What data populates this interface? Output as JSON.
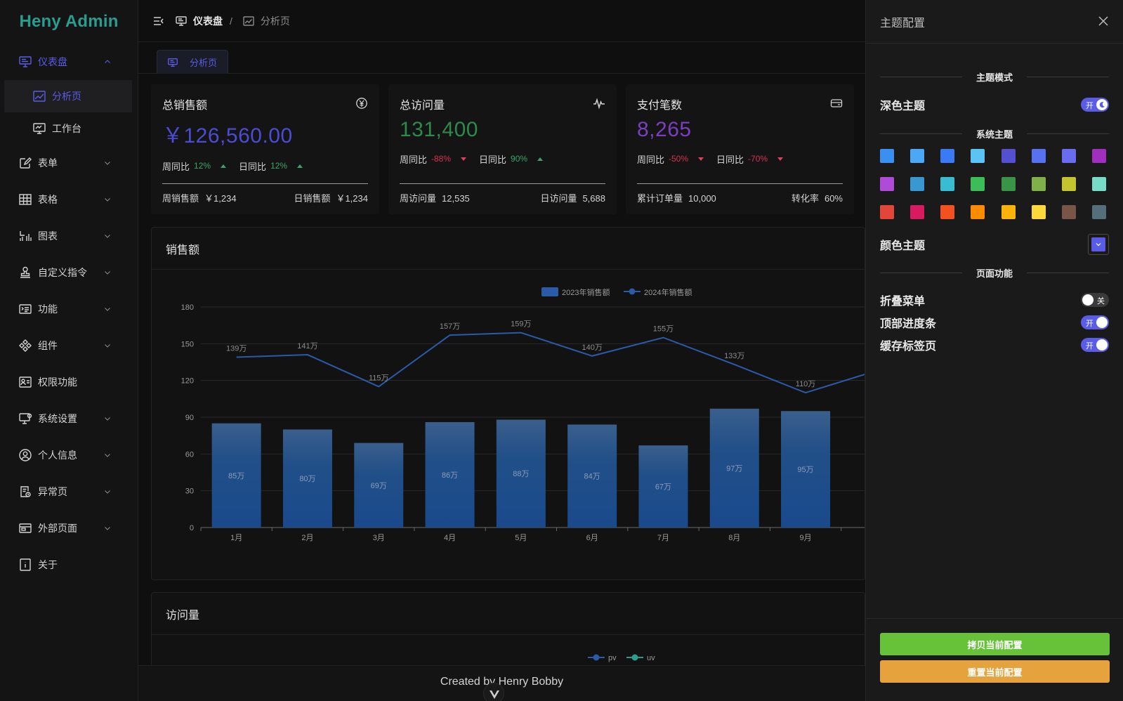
{
  "app": {
    "logo": "Heny Admin"
  },
  "sidebar": {
    "items": [
      {
        "label": "仪表盘",
        "icon": "monitor-icon",
        "expanded": true,
        "active": true,
        "children": [
          {
            "label": "分析页",
            "icon": "chart-image-icon",
            "active": true
          },
          {
            "label": "工作台",
            "icon": "desktop-icon",
            "active": false
          }
        ]
      },
      {
        "label": "表单",
        "icon": "edit-icon"
      },
      {
        "label": "表格",
        "icon": "table-icon"
      },
      {
        "label": "图表",
        "icon": "chart-icon"
      },
      {
        "label": "自定义指令",
        "icon": "stamp-icon"
      },
      {
        "label": "功能",
        "icon": "function-icon"
      },
      {
        "label": "组件",
        "icon": "component-icon"
      },
      {
        "label": "权限功能",
        "icon": "permission-icon"
      },
      {
        "label": "系统设置",
        "icon": "system-settings-icon"
      },
      {
        "label": "个人信息",
        "icon": "user-circle-icon"
      },
      {
        "label": "异常页",
        "icon": "exception-icon"
      },
      {
        "label": "外部页面",
        "icon": "external-page-icon"
      },
      {
        "label": "关于",
        "icon": "info-icon"
      }
    ]
  },
  "header": {
    "breadcrumb": [
      "仪表盘",
      "分析页"
    ],
    "separator": "/"
  },
  "tabs": [
    {
      "label": "分析页",
      "active": true
    }
  ],
  "stats": [
    {
      "title": "总销售额",
      "value": "￥126,560.00",
      "value_color": "#4a4dd4",
      "icon": "yen-icon",
      "week_label": "周同比",
      "week_pct": "12%",
      "week_trend": "up",
      "day_label": "日同比",
      "day_pct": "12%",
      "day_trend": "up",
      "foot_left_label": "周销售额",
      "foot_left_value": "￥1,234",
      "foot_right_label": "日销售额",
      "foot_right_value": "￥1,234"
    },
    {
      "title": "总访问量",
      "value": "131,400",
      "value_color": "#2e8a4a",
      "icon": "activity-icon",
      "week_label": "周同比",
      "week_pct": "-88%",
      "week_trend": "down",
      "day_label": "日同比",
      "day_pct": "90%",
      "day_trend": "up",
      "foot_left_label": "周访问量",
      "foot_left_value": "12,535",
      "foot_right_label": "日访问量",
      "foot_right_value": "5,688"
    },
    {
      "title": "支付笔数",
      "value": "8,265",
      "value_color": "#7a3fc0",
      "icon": "card-icon",
      "week_label": "周同比",
      "week_pct": "-50%",
      "week_trend": "down",
      "day_label": "日同比",
      "day_pct": "-70%",
      "day_trend": "down",
      "foot_left_label": "累计订单量",
      "foot_left_value": "10,000",
      "foot_right_label": "转化率",
      "foot_right_value": "60%"
    }
  ],
  "sales_panel": {
    "title": "销售额"
  },
  "visit_panel": {
    "title": "访问量",
    "legend": [
      "pv",
      "uv"
    ]
  },
  "chart_data": {
    "type": "bar",
    "title": "",
    "categories": [
      "1月",
      "2月",
      "3月",
      "4月",
      "5月",
      "6月",
      "7月",
      "8月",
      "9月"
    ],
    "series": [
      {
        "name": "2023年销售额",
        "type": "bar",
        "values": [
          85,
          80,
          69,
          86,
          88,
          84,
          67,
          97,
          95
        ],
        "labels": [
          "85万",
          "80万",
          "69万",
          "86万",
          "88万",
          "84万",
          "67万",
          "97万",
          "95万"
        ]
      },
      {
        "name": "2024年销售额",
        "type": "line",
        "values": [
          139,
          141,
          115,
          157,
          159,
          140,
          155,
          133,
          110
        ],
        "labels": [
          "139万",
          "141万",
          "115万",
          "157万",
          "159万",
          "140万",
          "155万",
          "133万",
          "110万"
        ]
      }
    ],
    "yticks": [
      0,
      30,
      60,
      90,
      120,
      150,
      180
    ],
    "ylim": [
      0,
      180
    ],
    "legend_position": "top-center",
    "grid": true
  },
  "footer": {
    "text": "Created by Henry Bobby"
  },
  "drawer": {
    "title": "主题配置",
    "sections": {
      "mode": "主题模式",
      "system": "系统主题",
      "page": "页面功能"
    },
    "dark_theme": {
      "label": "深色主题",
      "on": true,
      "on_text": "开"
    },
    "color_theme": {
      "label": "颜色主题",
      "value": "#5b5ce6"
    },
    "collapse_menu": {
      "label": "折叠菜单",
      "on": false,
      "off_text": "关"
    },
    "top_progress": {
      "label": "顶部进度条",
      "on": true,
      "on_text": "开"
    },
    "cache_tabs": {
      "label": "缓存标签页",
      "on": true,
      "on_text": "开"
    },
    "swatches": [
      [
        "#3b8ff0",
        "#4aa8f5",
        "#3a7bf5",
        "#5cc4f2",
        "#5450d0",
        "#5672f2",
        "#6a6cf0",
        "#a12fbd"
      ],
      [
        "#b04ad8",
        "#3898d0",
        "#38bcd2",
        "#3dbd58",
        "#3a9448",
        "#7fb04a",
        "#c4c42e",
        "#76dcc8"
      ],
      [
        "#e2463a",
        "#d81b60",
        "#f4511e",
        "#fb8c00",
        "#fbb30a",
        "#fdd83a",
        "#795548",
        "#546e7a"
      ]
    ],
    "copy_button": "拷贝当前配置",
    "reset_button": "重置当前配置"
  }
}
